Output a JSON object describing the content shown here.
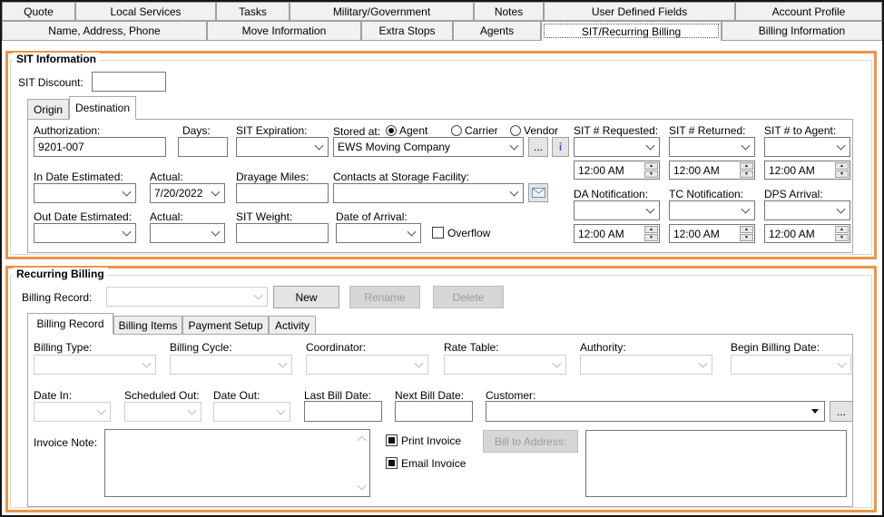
{
  "colors": {
    "accent_orange": "#ED9445"
  },
  "tabs_row1": [
    {
      "label": "Quote"
    },
    {
      "label": "Local Services"
    },
    {
      "label": "Tasks"
    },
    {
      "label": "Military/Government"
    },
    {
      "label": "Notes"
    },
    {
      "label": "User Defined Fields"
    },
    {
      "label": "Account Profile"
    }
  ],
  "tabs_row2": [
    {
      "label": "Name, Address, Phone"
    },
    {
      "label": "Move Information"
    },
    {
      "label": "Extra Stops"
    },
    {
      "label": "Agents"
    },
    {
      "label": "SIT/Recurring Billing",
      "selected": true
    },
    {
      "label": "Billing Information"
    }
  ],
  "sit": {
    "title": "SIT Information",
    "discount_label": "SIT Discount:",
    "discount_value": "",
    "subtabs": [
      {
        "label": "Origin"
      },
      {
        "label": "Destination",
        "selected": true
      }
    ],
    "authorization_label": "Authorization:",
    "authorization_value": "9201-007",
    "days_label": "Days:",
    "days_value": "",
    "expiration_label": "SIT Expiration:",
    "stored_at_label": "Stored at:",
    "stored_at_options": [
      {
        "label": "Agent",
        "selected": true
      },
      {
        "label": "Carrier",
        "selected": false
      },
      {
        "label": "Vendor",
        "selected": false
      }
    ],
    "stored_at_company": "EWS Moving Company",
    "browse_label": "...",
    "info_label": "i",
    "sit_requested_label": "SIT # Requested:",
    "sit_returned_label": "SIT # Returned:",
    "sit_to_agent_label": "SIT # to Agent:",
    "time_requested": "12:00 AM",
    "time_returned": "12:00 AM",
    "time_to_agent": "12:00 AM",
    "in_date_label": "In Date Estimated:",
    "in_actual_label": "Actual:",
    "in_actual_value": "7/20/2022",
    "drayage_label": "Drayage Miles:",
    "contacts_label": "Contacts at Storage Facility:",
    "da_label": "DA Notification:",
    "tc_label": "TC Notification:",
    "dps_label": "DPS Arrival:",
    "time_da": "12:00 AM",
    "time_tc": "12:00 AM",
    "time_dps": "12:00 AM",
    "out_date_label": "Out Date Estimated:",
    "out_actual_label": "Actual:",
    "weight_label": "SIT Weight:",
    "arrival_label": "Date of Arrival:",
    "overflow_label": "Overflow"
  },
  "recurring": {
    "title": "Recurring Billing",
    "record_label": "Billing Record:",
    "new_label": "New",
    "rename_label": "Rename",
    "delete_label": "Delete",
    "subtabs": [
      {
        "label": "Billing Record",
        "selected": true
      },
      {
        "label": "Billing Items"
      },
      {
        "label": "Payment Setup"
      },
      {
        "label": "Activity"
      }
    ],
    "billing_type_label": "Billing Type:",
    "billing_cycle_label": "Billing Cycle:",
    "coordinator_label": "Coordinator:",
    "rate_table_label": "Rate Table:",
    "authority_label": "Authority:",
    "begin_date_label": "Begin Billing Date:",
    "date_in_label": "Date In:",
    "scheduled_out_label": "Scheduled Out:",
    "date_out_label": "Date Out:",
    "last_bill_label": "Last Bill Date:",
    "next_bill_label": "Next Bill Date:",
    "customer_label": "Customer:",
    "browse_label": "...",
    "invoice_note_label": "Invoice Note:",
    "print_invoice_label": "Print Invoice",
    "email_invoice_label": "Email Invoice",
    "bill_to_address_label": "Bill to Address:"
  }
}
